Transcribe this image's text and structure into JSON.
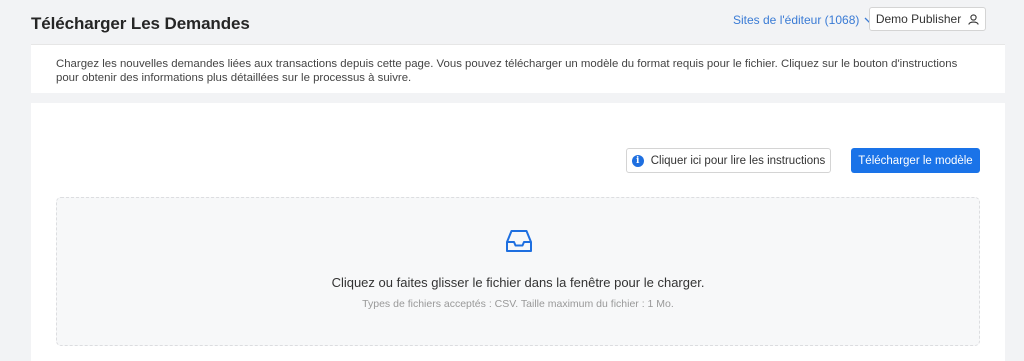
{
  "header": {
    "title": "Télécharger Les Demandes",
    "sites_link": "Sites de l'éditeur (1068)",
    "publisher_button": "Demo Publisher"
  },
  "info": {
    "text": "Chargez les nouvelles demandes liées aux transactions depuis cette page. Vous pouvez télécharger un modèle du format requis pour le fichier. Cliquez sur le bouton d'instructions pour obtenir des informations plus détaillées sur le processus à suivre."
  },
  "actions": {
    "instructions_label": "Cliquer ici pour lire les instructions",
    "download_label": "Télécharger le modèle"
  },
  "dropzone": {
    "main_text": "Cliquez ou faites glisser le fichier dans la fenêtre pour le charger.",
    "hint_text": "Types de fichiers acceptés : CSV. Taille maximum du fichier : 1 Mo."
  },
  "colors": {
    "accent": "#1a73e8",
    "link": "#3a7bd5",
    "icon": "#1e6fe0"
  },
  "icons": {
    "sites_chevron": "chevron-down-icon",
    "publisher": "user-icon",
    "instructions": "info-icon",
    "dropzone": "inbox-icon"
  }
}
